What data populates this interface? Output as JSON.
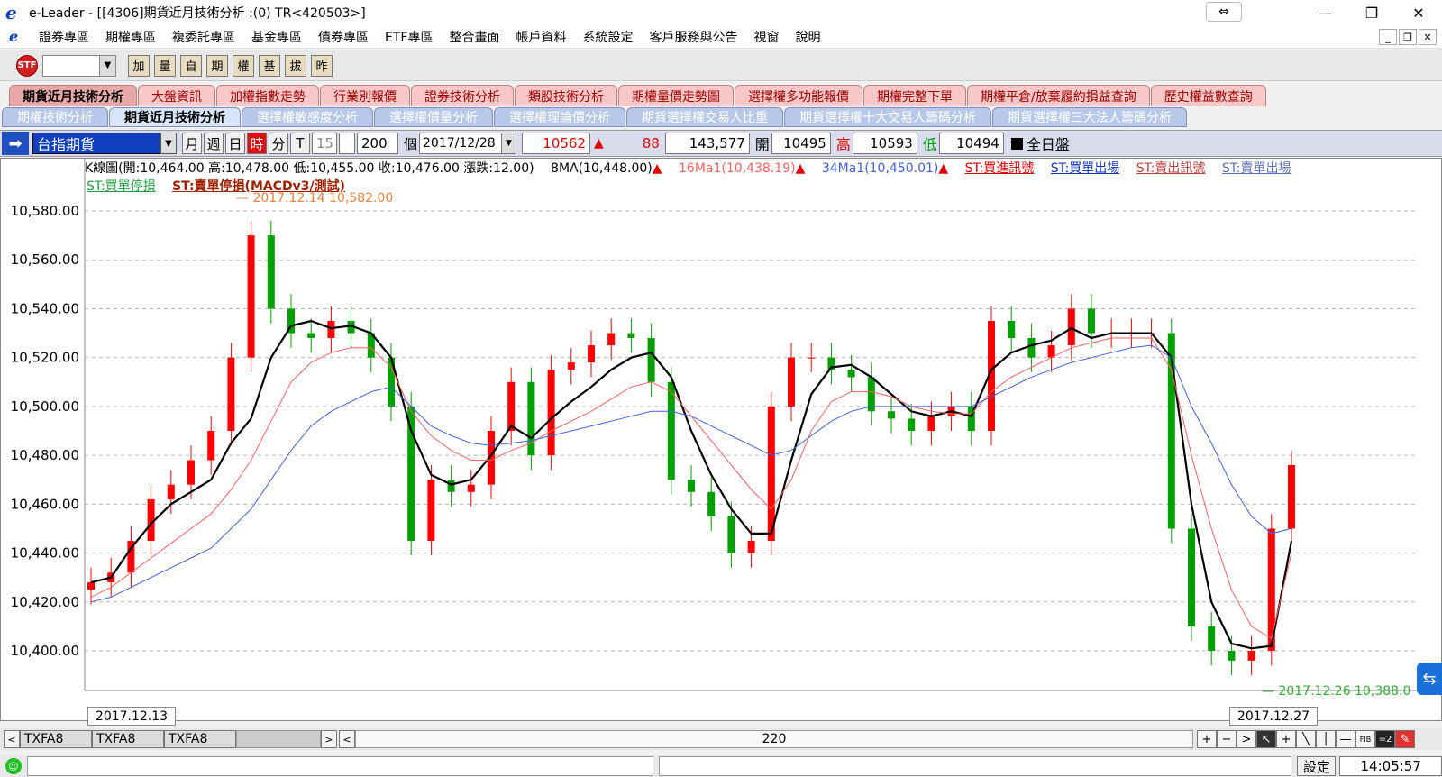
{
  "window": {
    "title": "e-Leader - [[4306]期貨近月技術分析 :(0) TR<420503>]",
    "logo": "e"
  },
  "menu": [
    "證券專區",
    "期權專區",
    "複委託專區",
    "基金專區",
    "債券專區",
    "ETF專區",
    "整合畫面",
    "帳戶資料",
    "系統設定",
    "客戶服務與公告",
    "視窗",
    "說明"
  ],
  "toolbar": {
    "logo_text": "STF",
    "buttons": [
      "加",
      "量",
      "自",
      "期",
      "權",
      "基",
      "拔",
      "昨"
    ]
  },
  "tabs_top": [
    {
      "label": "期貨近月技術分析",
      "active": true
    },
    {
      "label": "大盤資訊"
    },
    {
      "label": "加權指數走勢"
    },
    {
      "label": "行業別報價"
    },
    {
      "label": "證券技術分析"
    },
    {
      "label": "類股技術分析"
    },
    {
      "label": "期權量價走勢圖"
    },
    {
      "label": "選擇權多功能報價"
    },
    {
      "label": "期權完整下單"
    },
    {
      "label": "期權平倉/放棄履約損益查詢"
    },
    {
      "label": "歷史權益數查詢"
    }
  ],
  "tabs_sub": [
    {
      "label": "期權技術分析"
    },
    {
      "label": "期貨近月技術分析",
      "active": true
    },
    {
      "label": "選擇權敏感度分析"
    },
    {
      "label": "選擇權價量分析"
    },
    {
      "label": "選擇權理論價分析"
    },
    {
      "label": "期貨選擇權交易人比重"
    },
    {
      "label": "期貨選擇權十大交易人籌碼分析"
    },
    {
      "label": "期貨選擇權三大法人籌碼分析"
    }
  ],
  "control": {
    "symbol": "台指期貨",
    "periods": [
      "月",
      "週",
      "日",
      "時",
      "分",
      "T"
    ],
    "selected_period": "時",
    "minute_value": "15",
    "count": "200",
    "count_unit": "個",
    "date": "2017/12/28",
    "last": "10562",
    "change": "88",
    "volume": "143,577",
    "open_label": "開",
    "open": "10495",
    "high_label": "高",
    "high": "10593",
    "low_label": "低",
    "low": "10494",
    "session": "全日盤"
  },
  "legend": {
    "kline": "K線圖(開:10,464.00 高:10,478.00 低:10,455.00 收:10,476.00 漲跌:12.00)",
    "ma8": "8MA(10,448.00)",
    "ma16": "16Ma1(10,438.19)",
    "ma34": "34Ma1(10,450.01)",
    "st_buy_signal": "ST:買進訊號",
    "st_buy_exit": "ST:買單出場",
    "st_sell_signal": "ST:賣出訊號",
    "st_sell_exit": "ST:賣單出場",
    "st_buy_stop": "ST:買單停損",
    "st_sell_stop": "ST:賣單停損(MACDv3/測試)",
    "high_note": "2017.12.14  10,582.00",
    "low_note": "2017.12.26  10,388.0"
  },
  "colors": {
    "up": "#ff0000",
    "down": "#00a000",
    "ma8": "#000000",
    "ma16": "#ff6060",
    "ma34": "#4060e0",
    "buy_arrow": "#1030d0",
    "sell_arrow": "#ff6060"
  },
  "chart_data": {
    "type": "line",
    "title": "",
    "ylim": [
      10388,
      10590
    ],
    "yticks": [
      "10,580.00",
      "10,560.00",
      "10,540.00",
      "10,520.00",
      "10,500.00",
      "10,480.00",
      "10,460.00",
      "10,440.00",
      "10,420.00",
      "10,400.00"
    ],
    "ytick_values": [
      10580,
      10560,
      10540,
      10520,
      10500,
      10480,
      10460,
      10440,
      10420,
      10400
    ],
    "x_start_label": "2017.12.13",
    "x_end_label": "2017.12.27",
    "series": [
      {
        "name": "8MA",
        "values": [
          10428,
          10430,
          10442,
          10452,
          10460,
          10465,
          10470,
          10485,
          10495,
          10520,
          10533,
          10535,
          10532,
          10533,
          10530,
          10520,
          10490,
          10472,
          10468,
          10470,
          10480,
          10492,
          10487,
          10495,
          10502,
          10508,
          10515,
          10520,
          10522,
          10512,
          10490,
          10472,
          10458,
          10448,
          10448,
          10478,
          10505,
          10516,
          10517,
          10512,
          10505,
          10498,
          10496,
          10498,
          10496,
          10515,
          10522,
          10525,
          10527,
          10532,
          10528,
          10530,
          10530,
          10530,
          10520,
          10460,
          10420,
          10403,
          10401,
          10402,
          10445
        ]
      },
      {
        "name": "16Ma1",
        "values": [
          10422,
          10426,
          10432,
          10438,
          10444,
          10450,
          10456,
          10466,
          10478,
          10494,
          10510,
          10518,
          10522,
          10524,
          10524,
          10516,
          10498,
          10488,
          10482,
          10478,
          10478,
          10482,
          10485,
          10490,
          10494,
          10498,
          10503,
          10508,
          10510,
          10506,
          10496,
          10486,
          10476,
          10466,
          10458,
          10470,
          10490,
          10502,
          10506,
          10506,
          10504,
          10500,
          10498,
          10497,
          10497,
          10506,
          10512,
          10516,
          10520,
          10524,
          10526,
          10528,
          10528,
          10528,
          10515,
          10480,
          10450,
          10425,
          10410,
          10405,
          10440
        ]
      },
      {
        "name": "34Ma1",
        "values": [
          10420,
          10422,
          10426,
          10430,
          10434,
          10438,
          10442,
          10450,
          10458,
          10470,
          10482,
          10492,
          10498,
          10502,
          10506,
          10508,
          10500,
          10492,
          10488,
          10485,
          10484,
          10485,
          10486,
          10488,
          10490,
          10492,
          10494,
          10496,
          10498,
          10498,
          10496,
          10492,
          10488,
          10484,
          10480,
          10482,
          10488,
          10494,
          10498,
          10500,
          10500,
          10500,
          10500,
          10500,
          10500,
          10504,
          10508,
          10512,
          10515,
          10518,
          10520,
          10522,
          10524,
          10525,
          10520,
          10500,
          10485,
          10468,
          10455,
          10448,
          10450
        ]
      }
    ],
    "candles": {
      "values_close": [
        10428,
        10432,
        10445,
        10462,
        10468,
        10478,
        10490,
        10520,
        10570,
        10540,
        10530,
        10528,
        10535,
        10530,
        10520,
        10500,
        10445,
        10470,
        10465,
        10468,
        10490,
        10510,
        10480,
        10515,
        10518,
        10525,
        10530,
        10528,
        10510,
        10470,
        10465,
        10455,
        10440,
        10445,
        10500,
        10520,
        10520,
        10515,
        10512,
        10498,
        10495,
        10490,
        10496,
        10500,
        10490,
        10535,
        10528,
        10520,
        10525,
        10540,
        10530,
        10530,
        10530,
        10530,
        10450,
        10410,
        10400,
        10396,
        10400,
        10450,
        10476
      ]
    }
  },
  "scroll": {
    "symbols": [
      "TXFA8",
      "TXFA8",
      "TXFA8"
    ],
    "center_value": "220"
  },
  "status": {
    "settings_label": "設定",
    "time": "14:05:57"
  }
}
